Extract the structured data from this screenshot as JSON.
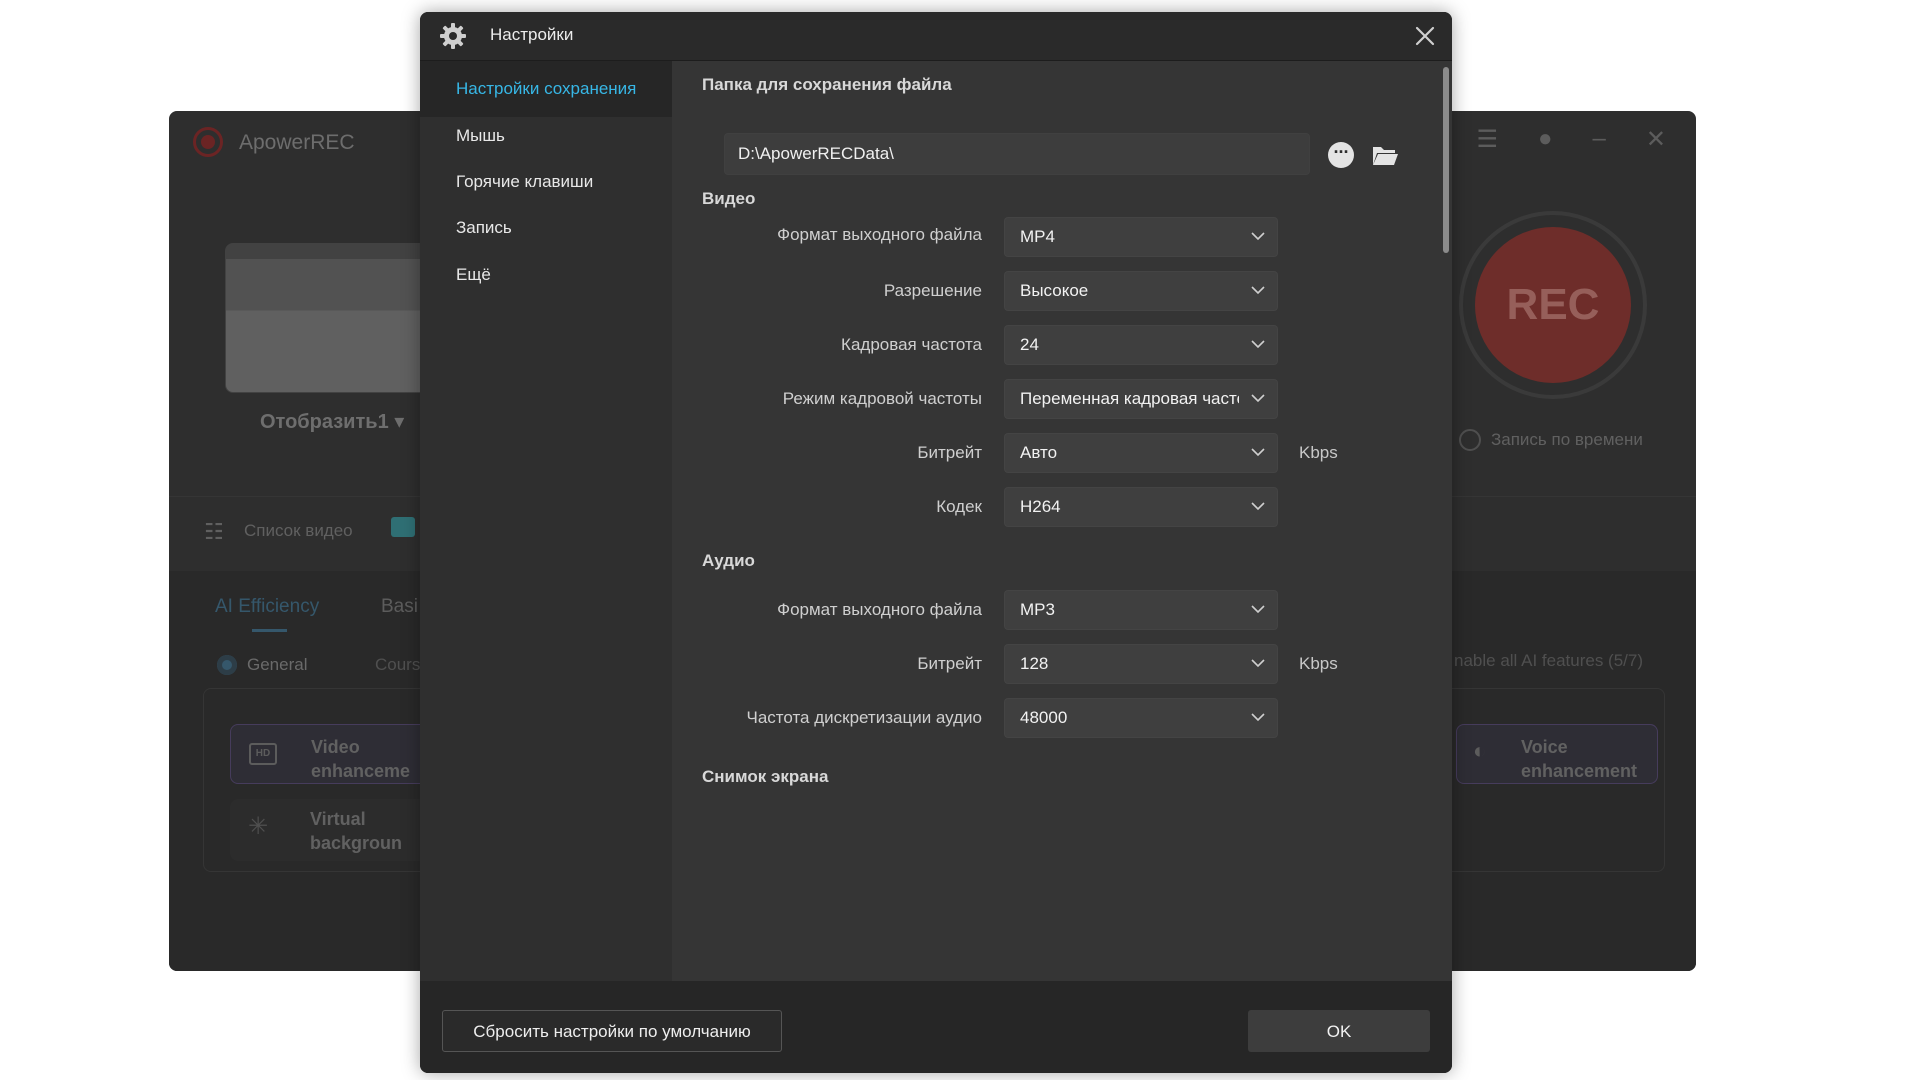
{
  "background_app": {
    "title": "ApowerREC",
    "screen_caption": "Отобразить1 ▾",
    "rec_label": "REC",
    "timer_label": "Запись по времени",
    "video_list_label": "Список видео",
    "tabs": [
      "AI Efficiency",
      "Basi"
    ],
    "radio_general": "General",
    "radio_course": "Cours",
    "enable_all": "nable all AI features (5/7)",
    "cards": {
      "video": "Video enhanceme",
      "virtual": "Virtual backgroun",
      "voice": "Voice enhancement"
    }
  },
  "dialog": {
    "title": "Настройки",
    "nav": [
      {
        "label": "Настройки сохранения",
        "active": true
      },
      {
        "label": "Мышь",
        "active": false
      },
      {
        "label": "Горячие клавиши",
        "active": false
      },
      {
        "label": "Запись",
        "active": false
      },
      {
        "label": "Ещё",
        "active": false
      }
    ],
    "save_folder": {
      "title": "Папка для сохранения файла",
      "path": "D:\\ApowerRECData\\"
    },
    "video": {
      "title": "Видео",
      "format_label": "Формат выходного файла",
      "format_value": "MP4",
      "resolution_label": "Разрешение",
      "resolution_value": "Высокое",
      "framerate_label": "Кадровая частота",
      "framerate_value": "24",
      "framerate_mode_label": "Режим кадровой частоты",
      "framerate_mode_value": "Переменная кадровая частота",
      "bitrate_label": "Битрейт",
      "bitrate_value": "Авто",
      "bitrate_unit": "Kbps",
      "codec_label": "Кодек",
      "codec_value": "H264"
    },
    "audio": {
      "title": "Аудио",
      "format_label": "Формат выходного файла",
      "format_value": "MP3",
      "bitrate_label": "Битрейт",
      "bitrate_value": "128",
      "bitrate_unit": "Kbps",
      "samplerate_label": "Частота дискретизации аудио",
      "samplerate_value": "48000"
    },
    "screenshot": {
      "title": "Снимок экрана"
    },
    "footer": {
      "reset_label": "Сбросить настройки по умолчанию",
      "ok_label": "OK"
    }
  },
  "colors": {
    "accent": "#37b7e6",
    "dialog_bg": "#2d2d2d",
    "content_bg": "#353535",
    "rec_red": "#8e3a36"
  },
  "icons": [
    "gear-icon",
    "close-icon",
    "more-icon",
    "folder-icon",
    "chevron-down-icon"
  ]
}
